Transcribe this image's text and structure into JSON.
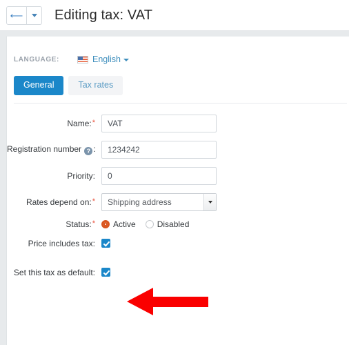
{
  "header": {
    "back_icon": "arrow-left-icon",
    "dropdown_icon": "chevron-down-icon",
    "title": "Editing tax: VAT"
  },
  "language": {
    "label": "LANGUAGE:",
    "flag_icon": "us-flag-icon",
    "value": "English",
    "caret_icon": "caret-down-icon"
  },
  "tabs": [
    {
      "label": "General",
      "active": true
    },
    {
      "label": "Tax rates",
      "active": false
    }
  ],
  "form": {
    "name": {
      "label": "Name:",
      "required": "*",
      "value": "VAT",
      "placeholder": ""
    },
    "registration_number": {
      "label": "Registration number",
      "help_icon": "question-mark-icon",
      "suffix": ":",
      "value": "1234242",
      "placeholder": ""
    },
    "priority": {
      "label": "Priority:",
      "value": "0",
      "placeholder": ""
    },
    "rates_depend_on": {
      "label": "Rates depend on:",
      "required": "*",
      "value": "Shipping address",
      "arrow_icon": "select-arrow-icon"
    },
    "status": {
      "label": "Status:",
      "required": "*",
      "options": [
        {
          "label": "Active",
          "checked": true
        },
        {
          "label": "Disabled",
          "checked": false
        }
      ]
    },
    "price_includes_tax": {
      "label": "Price includes tax:",
      "checked": true
    },
    "set_default": {
      "label": "Set this tax as default:",
      "checked": true
    }
  },
  "annotation": {
    "arrow_icon": "red-arrow-left-icon",
    "color": "#fa0000"
  },
  "colors": {
    "accent": "#1b87c9",
    "link": "#3c8dbc",
    "required": "#e8503a",
    "radio_active": "#d9541e",
    "page_bg": "#e7eaec",
    "panel_bg": "#ffffff"
  }
}
